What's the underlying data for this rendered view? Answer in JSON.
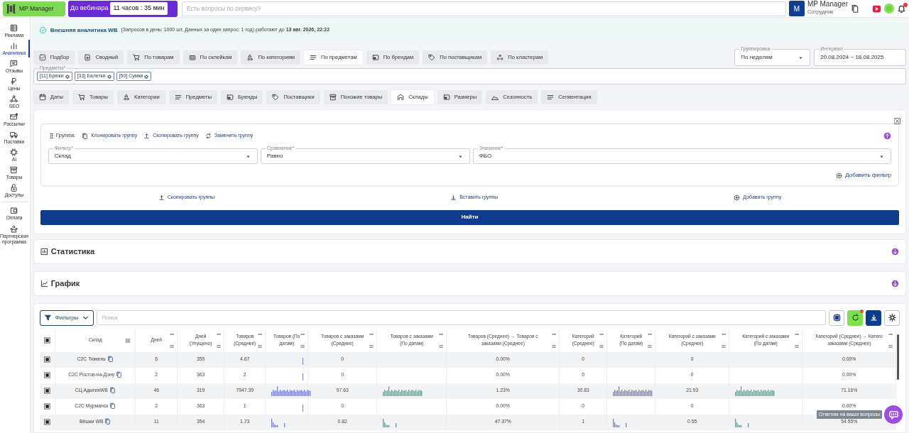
{
  "header": {
    "logo": "MP Manager",
    "webinar_label": "До вебинара",
    "webinar_timer": "11 часов : 35 мин",
    "search": {
      "placeholder": "Есть вопросы по сервису?"
    },
    "user": {
      "initial": "M",
      "name": "MP Manager",
      "role": "Сотрудник"
    }
  },
  "sidebar": {
    "items": [
      {
        "label": "Реклама",
        "selected": false
      },
      {
        "label": "Аналитика",
        "selected": true
      },
      {
        "label": "Отзывы",
        "selected": false
      },
      {
        "label": "Цены",
        "selected": false
      },
      {
        "label": "SEO",
        "selected": false
      },
      {
        "label": "Рассылки",
        "selected": false
      },
      {
        "label": "Поставки",
        "selected": false
      },
      {
        "label": "AI",
        "selected": false
      },
      {
        "label": "Товары",
        "selected": false
      },
      {
        "label": "Доступы",
        "selected": false
      },
      {
        "label": "Оплата",
        "selected": false
      },
      {
        "label": "Партнерская программа",
        "selected": false
      }
    ]
  },
  "banner": {
    "title": "Внешняя аналитика WB",
    "text": "(Запросов в день: 1000 шт, Данных за один запрос: 1 год) работают до **13 авг. 2026, 22:22**"
  },
  "report_tabs": [
    {
      "label": "Подбор",
      "selected": false
    },
    {
      "label": "Сводный",
      "selected": false
    },
    {
      "label": "По товарам",
      "selected": false
    },
    {
      "label": "По склейкам",
      "selected": false
    },
    {
      "label": "По категориям",
      "selected": false
    },
    {
      "label": "По предметам",
      "selected": true
    },
    {
      "label": "По брендам",
      "selected": false
    },
    {
      "label": "По поставщикам",
      "selected": false
    },
    {
      "label": "По кластерам",
      "selected": false
    }
  ],
  "grouping": {
    "label": "Группировка",
    "value": "По неделям"
  },
  "interval": {
    "label": "Интервал",
    "value": "20.08.2024 ~ 18.08.2025"
  },
  "subjects": {
    "label": "Предметы*",
    "chips": [
      "[11] Брюки",
      "[33] Балетки",
      "[50] Сумки"
    ]
  },
  "section_tabs": [
    {
      "label": "Даты",
      "selected": false
    },
    {
      "label": "Товары",
      "selected": false
    },
    {
      "label": "Категории",
      "selected": false
    },
    {
      "label": "Предметы",
      "selected": false
    },
    {
      "label": "Бренды",
      "selected": false
    },
    {
      "label": "Поставщики",
      "selected": false
    },
    {
      "label": "Похожие товары",
      "selected": false
    },
    {
      "label": "Склады",
      "selected": true
    },
    {
      "label": "Размеры",
      "selected": false
    },
    {
      "label": "Сезонность",
      "selected": false
    },
    {
      "label": "Сегментация",
      "selected": false
    }
  ],
  "group": {
    "title": "Группа:",
    "actions": [
      "Клонировать группу",
      "Скопировать группу",
      "Заменить группу"
    ],
    "filters": [
      {
        "label": "Фильтр*",
        "value": "Склад"
      },
      {
        "label": "Сравнение*",
        "value": "Равно"
      },
      {
        "label": "Значение*",
        "value": "ФБО"
      }
    ],
    "add_filter": "Добавить фильтр"
  },
  "group_actions": [
    "Скопировать группы",
    "Вставить группы",
    "Добавить группу"
  ],
  "find_button": "Найти",
  "panels": [
    {
      "title": "Статистика",
      "expanded": false
    },
    {
      "title": "График",
      "expanded": false
    }
  ],
  "table": {
    "filters_button": "Фильтры",
    "search": {
      "placeholder": "Поиск"
    },
    "columns": [
      {
        "lines": [
          "Склад"
        ],
        "kind": "name"
      },
      {
        "lines": [
          "Дней"
        ],
        "kind": "text"
      },
      {
        "lines": [
          "Дней",
          "(Упущено)"
        ],
        "kind": "text"
      },
      {
        "lines": [
          "Товаров",
          "(Среднее)"
        ],
        "kind": "text"
      },
      {
        "lines": [
          "Товаров (По",
          "датам)"
        ],
        "kind": "spark"
      },
      {
        "lines": [
          "Товаров с заказами",
          "(Среднее)"
        ],
        "kind": "text"
      },
      {
        "lines": [
          "Товаров с заказами",
          "(По датам)"
        ],
        "kind": "spark"
      },
      {
        "lines": [
          "Товаров (Среднее) → Товаров с",
          "заказами (Среднее)"
        ],
        "kind": "text"
      },
      {
        "lines": [
          "Категорий",
          "(Среднее)"
        ],
        "kind": "text"
      },
      {
        "lines": [
          "Категорий",
          "(По датам)"
        ],
        "kind": "spark"
      },
      {
        "lines": [
          "Категорий с заказами",
          "(Среднее)"
        ],
        "kind": "text"
      },
      {
        "lines": [
          "Категорий с заказами",
          "(По датам)"
        ],
        "kind": "spark"
      },
      {
        "lines": [
          "Категорий (Среднее) → Катего",
          "заказами (Среднее)"
        ],
        "kind": "text"
      }
    ],
    "rows": [
      {
        "cells": [
          "С2С Тюмень",
          "6",
          "359",
          "4.67",
          {
            "kind": "tick"
          },
          "0",
          "",
          "0.00%",
          "0",
          "",
          "0",
          "",
          "0.00%"
        ]
      },
      {
        "cells": [
          "С2С Ростов-на-Дону",
          "2",
          "363",
          "2",
          {
            "kind": "tick"
          },
          "0",
          "",
          "0.00%",
          "0",
          "",
          "0",
          "",
          "0.00%"
        ]
      },
      {
        "cells": [
          "СЦ АдыгеяWB",
          "46",
          "319",
          "7947.39",
          {
            "kind": "dense"
          },
          "97.63",
          {
            "kind": "dense"
          },
          "1.23%",
          "30.83",
          {
            "kind": "dense"
          },
          "21.93",
          {
            "kind": "dense"
          },
          "71.16%"
        ]
      },
      {
        "cells": [
          "С2С Мурманск",
          "2",
          "363",
          "1",
          {
            "kind": "tick"
          },
          "0",
          "",
          "0.00%",
          "0",
          "",
          "0",
          "",
          "0.00%"
        ]
      },
      {
        "cells": [
          "Вёшки WB",
          "11",
          "354",
          "1.73",
          {
            "kind": "sparse"
          },
          "0.82",
          {
            "kind": "sparse"
          },
          "47.37%",
          "1",
          {
            "kind": "sparse"
          },
          "0.55",
          {
            "kind": "sparse"
          },
          "54.55%"
        ]
      }
    ]
  },
  "chat": {
    "tooltip": "Ответим на ваши вопросы"
  }
}
